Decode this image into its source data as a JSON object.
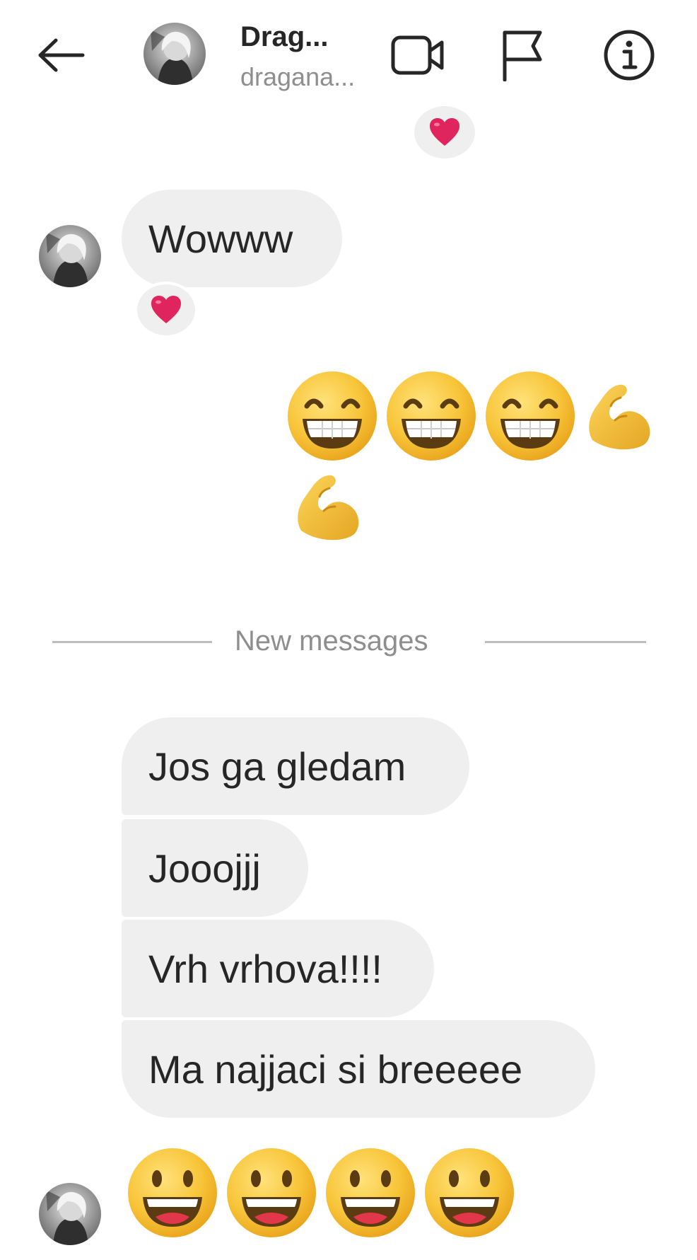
{
  "header": {
    "name": "Drag...",
    "handle": "dragana...",
    "icons": [
      "back-arrow-icon",
      "video-call-icon",
      "flag-icon",
      "info-icon"
    ]
  },
  "messages": {
    "top_reaction": "heart",
    "wowww": "Wowww",
    "wowww_reaction": "heart",
    "sent_emojis_line1": [
      "grinning-face-icon",
      "grinning-face-icon",
      "grinning-face-icon",
      "flexed-biceps-icon"
    ],
    "sent_emojis_line2": [
      "flexed-biceps-icon"
    ],
    "divider": "New messages",
    "incoming": [
      "Jos ga gledam",
      "Jooojjj",
      "Vrh vrhova!!!!",
      "Ma najjaci si breeeee"
    ],
    "bottom_emojis": [
      "smiling-face-icon",
      "smiling-face-icon",
      "smiling-face-icon",
      "smiling-face-icon"
    ]
  },
  "colors": {
    "bubble": "#efefef",
    "text": "#262626",
    "secondary_text": "#8e8e8e",
    "heart": "#e0245e",
    "emoji_yellow": "#f8c53a"
  }
}
